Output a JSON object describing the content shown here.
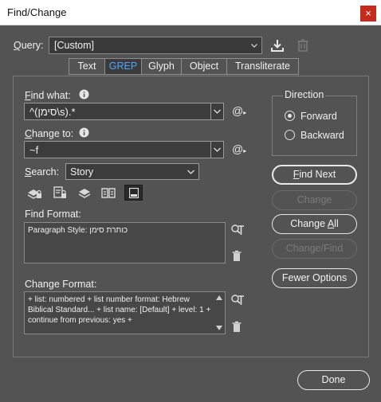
{
  "window": {
    "title": "Find/Change",
    "close_glyph": "×"
  },
  "query": {
    "label": "Query:",
    "value": "[Custom]"
  },
  "tabs": [
    {
      "label": "Text"
    },
    {
      "label": "GREP"
    },
    {
      "label": "Glyph"
    },
    {
      "label": "Object"
    },
    {
      "label": "Transliterate"
    }
  ],
  "active_tab": "GREP",
  "find_what": {
    "label": "Find what:",
    "value": "^(סימן\\s).*"
  },
  "change_to": {
    "label": "Change to:",
    "value": "~f"
  },
  "search": {
    "label": "Search:",
    "value": "Story"
  },
  "find_format": {
    "label": "Find Format:",
    "text": "Paragraph Style: כותרת סימן"
  },
  "change_format": {
    "label": "Change Format:",
    "text": " +  list: numbered +  list number format: Hebrew Biblical Standard... +  list name: [Default] + level: 1 +  continue from previous: yes +"
  },
  "direction": {
    "title": "Direction",
    "options": [
      {
        "label": "Forward"
      },
      {
        "label": "Backward"
      }
    ],
    "selected": "Forward"
  },
  "buttons": {
    "find_next": "Find Next",
    "change": "Change",
    "change_all": "Change All",
    "change_find": "Change/Find",
    "fewer_options": "Fewer Options",
    "done": "Done"
  },
  "colors": {
    "accent": "#4fa5ff",
    "background": "#535353",
    "close": "#c42b1c"
  }
}
